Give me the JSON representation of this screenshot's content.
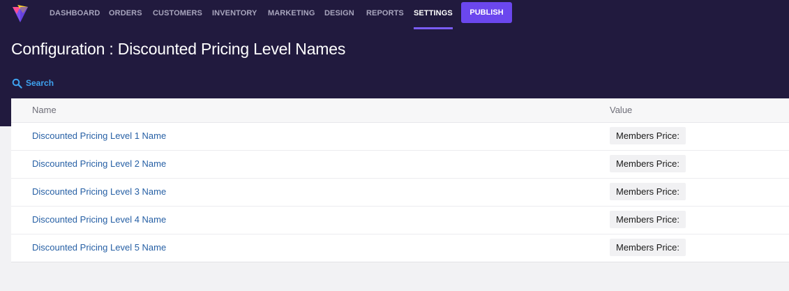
{
  "nav": {
    "items": [
      {
        "label": "DASHBOARD",
        "active": false
      },
      {
        "label": "ORDERS",
        "active": false
      },
      {
        "label": "CUSTOMERS",
        "active": false
      },
      {
        "label": "INVENTORY",
        "active": false
      },
      {
        "label": "MARKETING",
        "active": false
      },
      {
        "label": "DESIGN",
        "active": false
      },
      {
        "label": "REPORTS",
        "active": false
      },
      {
        "label": "SETTINGS",
        "active": true
      }
    ],
    "publish_label": "PUBLISH"
  },
  "page": {
    "title": "Configuration : Discounted Pricing Level Names",
    "search_label": "Search"
  },
  "table": {
    "columns": [
      "Name",
      "Value"
    ],
    "rows": [
      {
        "name": "Discounted Pricing Level 1 Name",
        "value": "Members Price:"
      },
      {
        "name": "Discounted Pricing Level 2 Name",
        "value": "Members Price:"
      },
      {
        "name": "Discounted Pricing Level 3 Name",
        "value": "Members Price:"
      },
      {
        "name": "Discounted Pricing Level 4 Name",
        "value": "Members Price:"
      },
      {
        "name": "Discounted Pricing Level 5 Name",
        "value": "Members Price:"
      }
    ]
  },
  "colors": {
    "header_bg": "#211a3e",
    "accent": "#6b47ee",
    "link": "#2760a5",
    "search": "#3ea3f0"
  },
  "icons": {
    "logo": "logo-icon",
    "search": "search-icon"
  }
}
